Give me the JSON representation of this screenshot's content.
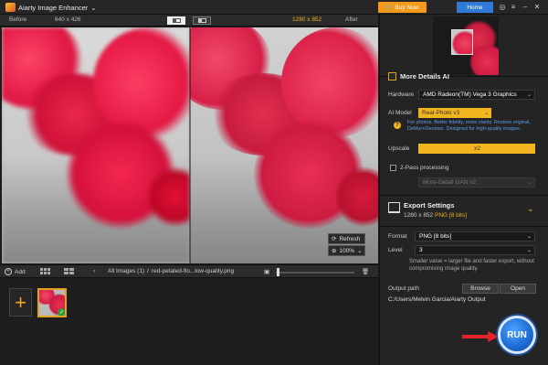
{
  "window": {
    "title": "Aiarty Image Enhancer",
    "buy_label": "Buy Now",
    "home_label": "Home"
  },
  "compare": {
    "before_label": "Before",
    "before_size": "640 x 426",
    "after_size": "1280 x 852",
    "after_label": "After"
  },
  "preview": {
    "refresh_label": "Refresh",
    "zoom_value": "100%"
  },
  "bottombar": {
    "add_label": "Add",
    "breadcrumb_all": "All Images (1)",
    "breadcrumb_sep": "/",
    "file_name": "red-petaled-flo...low-quality.png",
    "zoom_fraction": 0.03
  },
  "panel": {
    "more_details_title": "More Details AI",
    "hardware_label": "Hardware",
    "hardware_value": "AMD Radeon(TM) Vega 3 Graphics",
    "ai_model_label": "AI Model",
    "ai_model_value": "Real-Photo v3",
    "ai_model_desc": "For photos. Better fidelity, more clarity. Restore original, Deblur+Denoise. Designed for high-quality images.",
    "upscale_label": "Upscale",
    "upscale_value": "x2",
    "two_pass_label": "2-Pass processing",
    "two_pass_model": "More-Detail GAN v2",
    "export_title": "Export Settings",
    "export_size": "1280 x 852",
    "export_format_tag": "PNG",
    "export_bits_tag": "[8 bits]",
    "format_label": "Format",
    "format_value": "PNG  [8 bits]",
    "level_label": "Level",
    "level_value": "3",
    "level_info": "Smaller value = larger file and faster export, without compromising image quality.",
    "output_label": "Output path",
    "browse_label": "Browse",
    "open_label": "Open",
    "output_path": "C:/Users/Melvin Garcia/Aiarty Output",
    "run_label": "RUN"
  },
  "colors": {
    "accent": "#f0b51f",
    "home_blue": "#2f7ad6",
    "run_blue": "#1e6fd6",
    "petal_red": "#e62d52"
  }
}
